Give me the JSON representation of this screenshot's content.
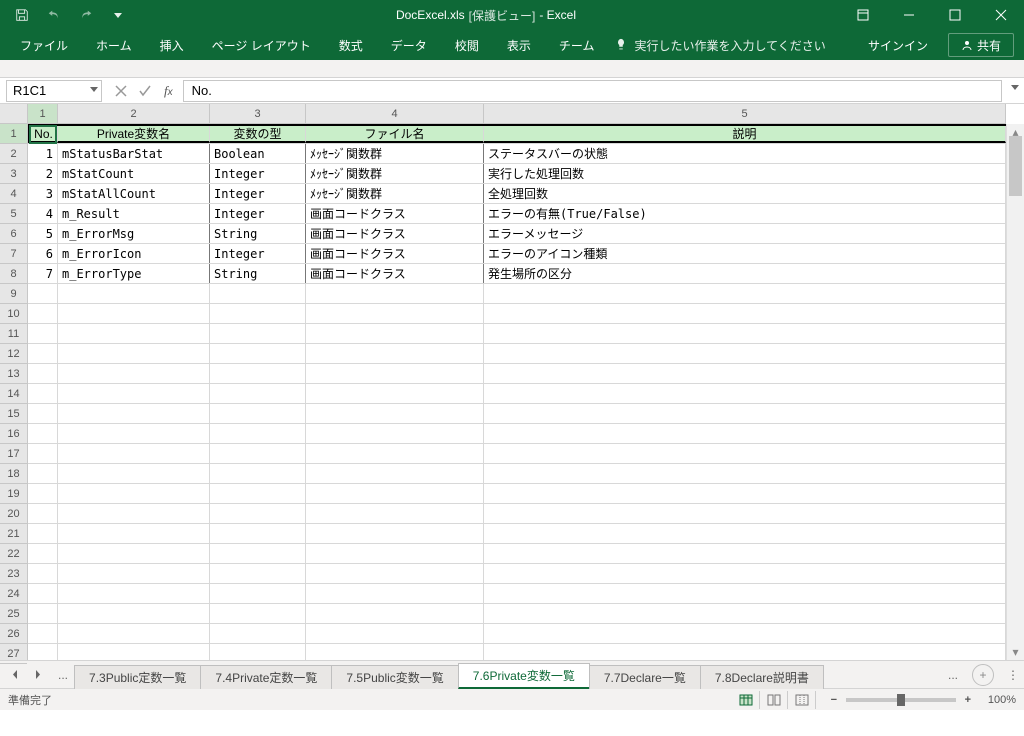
{
  "window": {
    "filename": "DocExcel.xls",
    "protected_view": "[保護ビュー]",
    "app": "- Excel"
  },
  "ribbon": {
    "tabs": [
      "ファイル",
      "ホーム",
      "挿入",
      "ページ レイアウト",
      "数式",
      "データ",
      "校閲",
      "表示",
      "チーム"
    ],
    "tell_me": "実行したい作業を入力してください",
    "sign_in": "サインイン",
    "share": "共有"
  },
  "formula_bar": {
    "name_box": "R1C1",
    "fx_content": "No."
  },
  "grid": {
    "col_numbers": [
      "1",
      "2",
      "3",
      "4",
      "5"
    ],
    "row_numbers": [
      "1",
      "2",
      "3",
      "4",
      "5",
      "6",
      "7",
      "8",
      "9",
      "10",
      "11",
      "12",
      "13",
      "14",
      "15",
      "16",
      "17",
      "18",
      "19",
      "20",
      "21",
      "22",
      "23",
      "24",
      "25",
      "26",
      "27"
    ],
    "headers": [
      "No.",
      "Private変数名",
      "変数の型",
      "ファイル名",
      "説明"
    ],
    "rows": [
      {
        "no": "1",
        "name": "mStatusBarStat",
        "type": "Boolean",
        "file": "ﾒｯｾｰｼﾞ関数群",
        "desc": "ステータスバーの状態"
      },
      {
        "no": "2",
        "name": "mStatCount",
        "type": "Integer",
        "file": "ﾒｯｾｰｼﾞ関数群",
        "desc": "実行した処理回数"
      },
      {
        "no": "3",
        "name": "mStatAllCount",
        "type": "Integer",
        "file": "ﾒｯｾｰｼﾞ関数群",
        "desc": "全処理回数"
      },
      {
        "no": "4",
        "name": "m_Result",
        "type": "Integer",
        "file": "画面コードクラス",
        "desc": "エラーの有無(True/False)"
      },
      {
        "no": "5",
        "name": "m_ErrorMsg",
        "type": "String",
        "file": "画面コードクラス",
        "desc": "エラーメッセージ"
      },
      {
        "no": "6",
        "name": "m_ErrorIcon",
        "type": "Integer",
        "file": "画面コードクラス",
        "desc": "エラーのアイコン種類"
      },
      {
        "no": "7",
        "name": "m_ErrorType",
        "type": "String",
        "file": "画面コードクラス",
        "desc": "発生場所の区分"
      }
    ]
  },
  "sheets": {
    "tabs": [
      "7.3Public定数一覧",
      "7.4Private定数一覧",
      "7.5Public変数一覧",
      "7.6Private変数一覧",
      "7.7Declare一覧",
      "7.8Declare説明書"
    ],
    "active_index": 3
  },
  "status": {
    "ready": "準備完了",
    "zoom": "100%"
  }
}
